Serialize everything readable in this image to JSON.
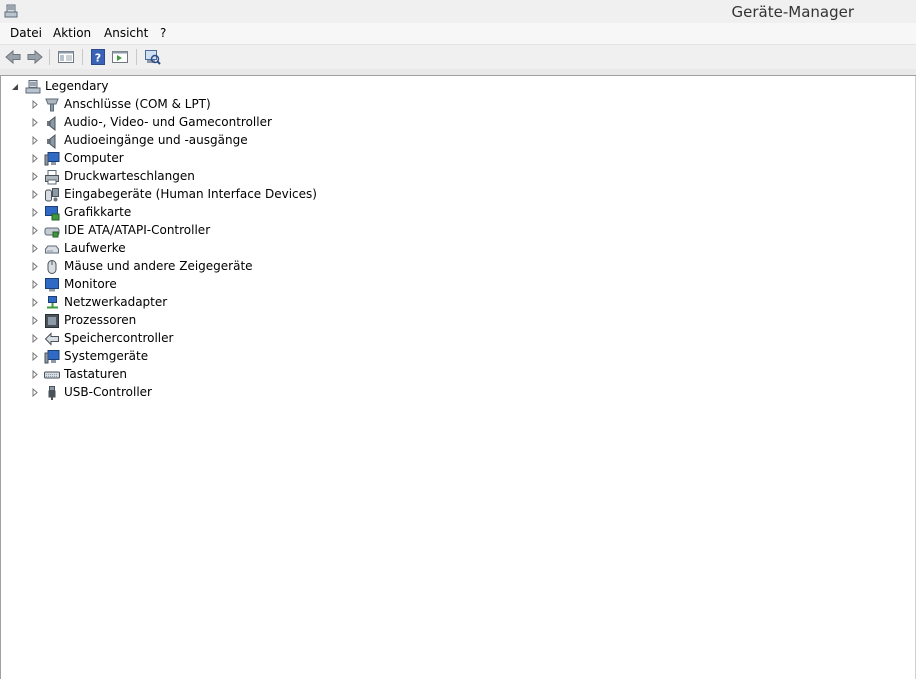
{
  "window": {
    "title": "Geräte-Manager"
  },
  "menu": {
    "items": [
      "Datei",
      "Aktion",
      "Ansicht",
      "?"
    ]
  },
  "toolbar": {
    "buttons": [
      "back-icon",
      "forward-icon",
      "properties-pane-icon",
      "help-icon",
      "action-pane-icon",
      "scan-hardware-icon"
    ]
  },
  "tree": {
    "root": {
      "label": "Legendary",
      "icon": "computer-root-icon",
      "expanded": true
    },
    "items": [
      {
        "label": "Anschlüsse (COM & LPT)",
        "icon": "port-icon"
      },
      {
        "label": "Audio-, Video- und Gamecontroller",
        "icon": "speaker-icon"
      },
      {
        "label": "Audioeingänge und -ausgänge",
        "icon": "speaker-icon"
      },
      {
        "label": "Computer",
        "icon": "computer-icon"
      },
      {
        "label": "Druckwarteschlangen",
        "icon": "printer-icon"
      },
      {
        "label": "Eingabegeräte (Human Interface Devices)",
        "icon": "hid-icon"
      },
      {
        "label": "Grafikkarte",
        "icon": "display-adapter-icon"
      },
      {
        "label": "IDE ATA/ATAPI-Controller",
        "icon": "ide-controller-icon"
      },
      {
        "label": "Laufwerke",
        "icon": "disk-drive-icon"
      },
      {
        "label": "Mäuse und andere Zeigegeräte",
        "icon": "mouse-icon"
      },
      {
        "label": "Monitore",
        "icon": "monitor-icon"
      },
      {
        "label": "Netzwerkadapter",
        "icon": "network-adapter-icon"
      },
      {
        "label": "Prozessoren",
        "icon": "processor-icon"
      },
      {
        "label": "Speichercontroller",
        "icon": "storage-controller-icon"
      },
      {
        "label": "Systemgeräte",
        "icon": "system-devices-icon"
      },
      {
        "label": "Tastaturen",
        "icon": "keyboard-icon"
      },
      {
        "label": "USB-Controller",
        "icon": "usb-icon"
      }
    ]
  }
}
